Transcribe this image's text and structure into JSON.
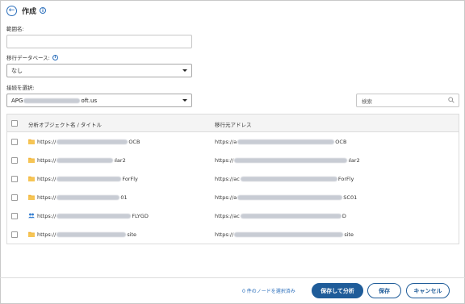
{
  "header": {
    "title": "作成"
  },
  "form": {
    "scope_name_label": "範囲名:",
    "scope_name_value": "",
    "migration_db_label": "移行データベース:",
    "migration_db_value": "なし",
    "connection_label": "接続を選択:",
    "connection_value_prefix": "APG",
    "connection_value_suffix": "oft.us"
  },
  "search": {
    "placeholder": "検索"
  },
  "table": {
    "col_object": "分析オブジェクト名 / タイトル",
    "col_source": "移行元アドレス",
    "rows": [
      {
        "icon": "folder-icon",
        "name_prefix": "https://",
        "name_suffix": "OCB",
        "addr_prefix": "https://a",
        "addr_suffix": "OCB"
      },
      {
        "icon": "folder-icon",
        "name_prefix": "https://",
        "name_suffix": "ılar2",
        "addr_prefix": "https://",
        "addr_suffix": "ılar2"
      },
      {
        "icon": "folder-icon",
        "name_prefix": "https://",
        "name_suffix": "ForFly",
        "addr_prefix": "https://ac",
        "addr_suffix": "ForFly"
      },
      {
        "icon": "folder-icon",
        "name_prefix": "https://",
        "name_suffix": "01",
        "addr_prefix": "https://a",
        "addr_suffix": "SC01"
      },
      {
        "icon": "group-icon",
        "name_prefix": "https://",
        "name_suffix": "FLYGD",
        "addr_prefix": "https://ac",
        "addr_suffix": "D"
      },
      {
        "icon": "folder-icon",
        "name_prefix": "https://",
        "name_suffix": "site",
        "addr_prefix": "https://",
        "addr_suffix": "site"
      }
    ]
  },
  "footer": {
    "selected_count": "0 件のノードを選択済み",
    "save_analyze": "保存して分析",
    "save": "保存",
    "cancel": "キャンセル"
  },
  "colors": {
    "accent": "#1f5c99",
    "link": "#2a6ebb",
    "folder": "#f2b53b",
    "group": "#2f7bd0"
  }
}
